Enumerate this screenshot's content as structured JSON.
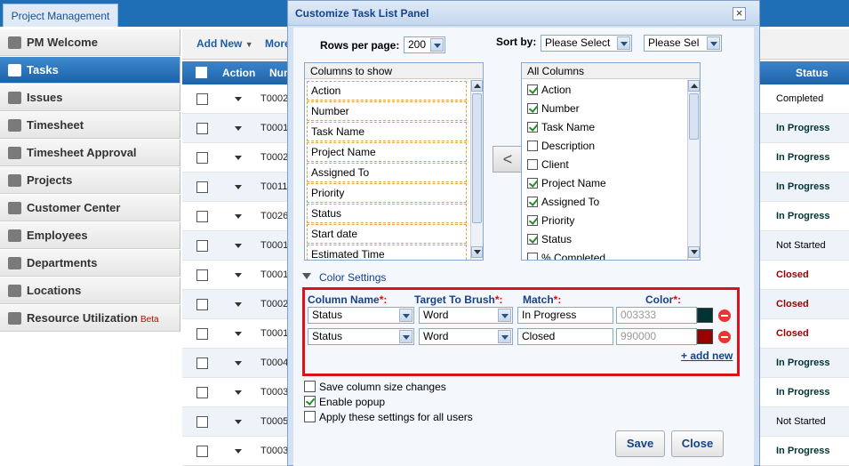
{
  "app": {
    "tab": "Project Management"
  },
  "sidebar": {
    "items": [
      {
        "label": "PM Welcome",
        "icon": "home-icon"
      },
      {
        "label": "Tasks",
        "icon": "tasks-icon",
        "active": true
      },
      {
        "label": "Issues",
        "icon": "issues-icon"
      },
      {
        "label": "Timesheet",
        "icon": "clock-icon"
      },
      {
        "label": "Timesheet Approval",
        "icon": "check-icon"
      },
      {
        "label": "Projects",
        "icon": "folder-icon"
      },
      {
        "label": "Customer Center",
        "icon": "customer-icon"
      },
      {
        "label": "Employees",
        "icon": "employees-icon"
      },
      {
        "label": "Departments",
        "icon": "cube-icon"
      },
      {
        "label": "Locations",
        "icon": "flag-icon"
      },
      {
        "label": "Resource Utilization",
        "icon": "resource-icon",
        "badge": "Beta"
      }
    ]
  },
  "toolbar": {
    "add_new": "Add New",
    "more": "More"
  },
  "grid": {
    "headers": {
      "action": "Action",
      "number": "Num",
      "status": "Status"
    },
    "rows": [
      {
        "number": "T0002",
        "status": "Completed"
      },
      {
        "number": "T0001",
        "status": "In Progress"
      },
      {
        "number": "T0002",
        "status": "In Progress"
      },
      {
        "number": "T0011",
        "status": "In Progress"
      },
      {
        "number": "T0026",
        "status": "In Progress"
      },
      {
        "number": "T0001",
        "status": "Not Started"
      },
      {
        "number": "T0001",
        "status": "Closed"
      },
      {
        "number": "T0002",
        "status": "Closed"
      },
      {
        "number": "T0001",
        "status": "Closed"
      },
      {
        "number": "T0004",
        "status": "In Progress"
      },
      {
        "number": "T0003",
        "status": "In Progress"
      },
      {
        "number": "T0005",
        "status": "Not Started"
      },
      {
        "number": "T0003",
        "status": "In Progress"
      }
    ],
    "status_colors": {
      "Completed": "#000000",
      "In Progress": "#003333",
      "Not Started": "#000000",
      "Closed": "#990000"
    }
  },
  "modal": {
    "title": "Customize Task List Panel",
    "close": "×",
    "rows_per_page_label": "Rows per page:",
    "rows_per_page": "200",
    "sort_by_label": "Sort by:",
    "sort1": "Please Select",
    "sort2": "Please Sel",
    "columns_to_show": {
      "title": "Columns to show",
      "items": [
        "Action",
        "Number",
        "Task Name",
        "Project Name",
        "Assigned To",
        "Priority",
        "Status",
        "Start date",
        "Estimated Time"
      ]
    },
    "move_left": "<",
    "all_columns": {
      "title": "All Columns",
      "items": [
        {
          "label": "Action",
          "checked": true
        },
        {
          "label": "Number",
          "checked": true
        },
        {
          "label": "Task Name",
          "checked": true
        },
        {
          "label": "Description",
          "checked": false
        },
        {
          "label": "Client",
          "checked": false
        },
        {
          "label": "Project Name",
          "checked": true
        },
        {
          "label": "Assigned To",
          "checked": true
        },
        {
          "label": "Priority",
          "checked": true
        },
        {
          "label": "Status",
          "checked": true
        },
        {
          "label": "% Completed",
          "checked": false
        }
      ]
    },
    "color_settings": {
      "title": "Color Settings",
      "headers": {
        "column_name": "Column Name",
        "target": "Target To Brush",
        "match": "Match",
        "color": "Color",
        "req": "*:"
      },
      "rules": [
        {
          "column": "Status",
          "target": "Word",
          "match": "In Progress",
          "color": "003333",
          "swatch": "#003333"
        },
        {
          "column": "Status",
          "target": "Word",
          "match": "Closed",
          "color": "990000",
          "swatch": "#990000"
        }
      ],
      "add_new": "+ add new"
    },
    "options": [
      {
        "label": "Save column size changes",
        "checked": false
      },
      {
        "label": "Enable popup",
        "checked": true
      },
      {
        "label": "Apply these settings for all users",
        "checked": false
      }
    ],
    "save": "Save",
    "close_btn": "Close"
  }
}
